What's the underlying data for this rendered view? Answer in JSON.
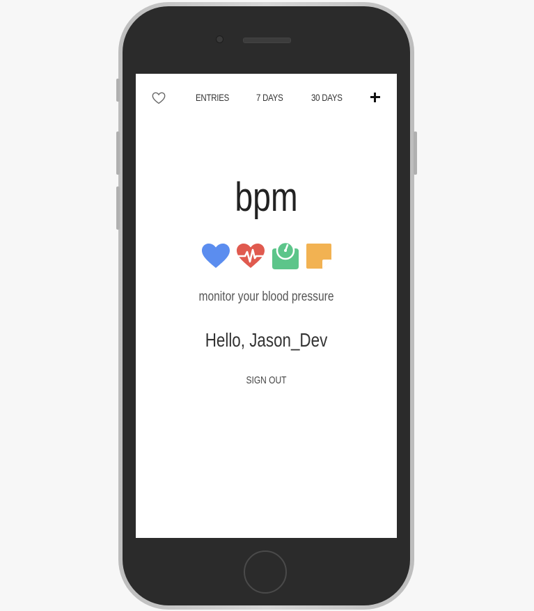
{
  "nav": {
    "home_icon": "heart-outline-icon",
    "entries_label": "ENTRIES",
    "seven_days_label": "7 DAYS",
    "thirty_days_label": "30 DAYS",
    "add_icon": "plus-icon"
  },
  "hero": {
    "logo": "bpm",
    "icons": [
      "heart-icon",
      "heartbeat-icon",
      "scale-icon",
      "note-icon"
    ],
    "tagline": "monitor your blood pressure",
    "greeting": "Hello, Jason_Dev",
    "signout_label": "SIGN OUT"
  },
  "colors": {
    "heart": "#5b8def",
    "heartbeat": "#e05a4f",
    "scale": "#5cc58a",
    "note": "#f2b252",
    "phone_body": "#2b2b2b"
  }
}
